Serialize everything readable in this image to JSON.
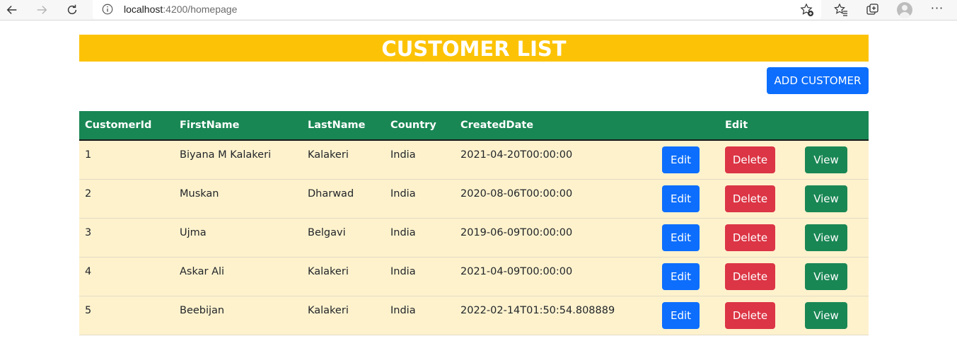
{
  "browser": {
    "url_host": "localhost",
    "url_path": ":4200/homepage"
  },
  "page": {
    "title": "CUSTOMER LIST",
    "add_button_label": "ADD CUSTOMER"
  },
  "table": {
    "headers": [
      "CustomerId",
      "FirstName",
      "LastName",
      "Country",
      "CreatedDate",
      "Edit"
    ],
    "rows": [
      {
        "id": "1",
        "first": "Biyana M Kalakeri",
        "last": "Kalakeri",
        "country": "India",
        "created": "2021-04-20T00:00:00"
      },
      {
        "id": "2",
        "first": "Muskan",
        "last": "Dharwad",
        "country": "India",
        "created": "2020-08-06T00:00:00"
      },
      {
        "id": "3",
        "first": "Ujma",
        "last": "Belgavi",
        "country": "India",
        "created": "2019-06-09T00:00:00"
      },
      {
        "id": "4",
        "first": "Askar Ali",
        "last": "Kalakeri",
        "country": "India",
        "created": "2021-04-09T00:00:00"
      },
      {
        "id": "5",
        "first": "Beebijan",
        "last": "Kalakeri",
        "country": "India",
        "created": "2022-02-14T01:50:54.808889"
      }
    ],
    "actions": {
      "edit_label": "Edit",
      "delete_label": "Delete",
      "view_label": "View"
    }
  },
  "colors": {
    "banner": "#fcc306",
    "header": "#198754",
    "row": "#fef2cd",
    "primary": "#0d6efd",
    "danger": "#dc3545",
    "success": "#198754"
  },
  "icons": [
    "back-arrow-icon",
    "forward-arrow-icon",
    "reload-icon",
    "info-icon",
    "add-favorite-icon",
    "favorites-icon",
    "collections-icon",
    "profile-avatar",
    "more-icon"
  ]
}
